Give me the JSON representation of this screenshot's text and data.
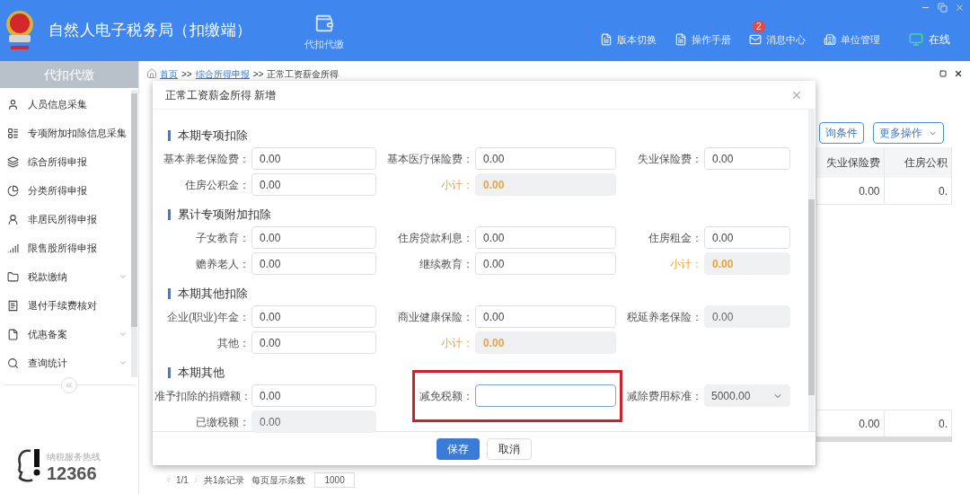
{
  "app": {
    "title": "自然人电子税务局（扣缴端）",
    "module": "代扣代缴"
  },
  "header_nav": [
    {
      "label": "版本切换",
      "kind": "link"
    },
    {
      "label": "操作手册",
      "kind": "link"
    },
    {
      "label": "消息中心",
      "kind": "link",
      "badge": "2"
    },
    {
      "label": "单位管理",
      "kind": "link"
    },
    {
      "label": "在线",
      "kind": "status"
    }
  ],
  "sidebar": {
    "title": "代扣代缴",
    "items": [
      {
        "label": "人员信息采集",
        "expandable": false
      },
      {
        "label": "专项附加扣除信息采集",
        "expandable": false
      },
      {
        "label": "综合所得申报",
        "expandable": false
      },
      {
        "label": "分类所得申报",
        "expandable": false
      },
      {
        "label": "非居民所得申报",
        "expandable": false
      },
      {
        "label": "限售股所得申报",
        "expandable": false
      },
      {
        "label": "税款缴纳",
        "expandable": true
      },
      {
        "label": "退付手续费核对",
        "expandable": false
      },
      {
        "label": "优惠备案",
        "expandable": true
      },
      {
        "label": "查询统计",
        "expandable": true
      }
    ],
    "hotline_label": "纳税服务热线",
    "hotline_number": "12366"
  },
  "breadcrumb": {
    "separator": ">>",
    "items": [
      {
        "label": "首页",
        "link": true
      },
      {
        "label": "综合所得申报",
        "link": true
      },
      {
        "label": "正常工资薪金所得",
        "link": false
      }
    ]
  },
  "background": {
    "buttons": [
      {
        "label": "询条件",
        "menu": false
      },
      {
        "label": "更多操作",
        "menu": true
      }
    ],
    "table": {
      "columns": [
        "失业保险费",
        "住房公积"
      ],
      "rows": [
        [
          "0.00",
          "0."
        ]
      ],
      "totals": [
        "0.00",
        "0."
      ]
    },
    "pagination": {
      "pages": "1/1",
      "total": "共1条记录",
      "page_size_label": "每页显示条数",
      "page_size": "1000"
    }
  },
  "dialog": {
    "title": "正常工资薪金所得 新增",
    "sections": [
      {
        "title": "本期专项扣除",
        "rows": [
          [
            {
              "label": "基本养老保险费：",
              "value": "0.00",
              "kind": "input"
            },
            {
              "label": "基本医疗保险费：",
              "value": "0.00",
              "kind": "input"
            },
            {
              "label": "失业保险费：",
              "value": "0.00",
              "kind": "input"
            }
          ],
          [
            {
              "label": "住房公积金：",
              "value": "0.00",
              "kind": "input"
            },
            {
              "label": "小计：",
              "value": "0.00",
              "kind": "subtotal"
            },
            null
          ]
        ]
      },
      {
        "title": "累计专项附加扣除",
        "rows": [
          [
            {
              "label": "子女教育：",
              "value": "0.00",
              "kind": "input"
            },
            {
              "label": "住房贷款利息：",
              "value": "0.00",
              "kind": "input"
            },
            {
              "label": "住房租金：",
              "value": "0.00",
              "kind": "input"
            }
          ],
          [
            {
              "label": "赡养老人：",
              "value": "0.00",
              "kind": "input"
            },
            {
              "label": "继续教育：",
              "value": "0.00",
              "kind": "input"
            },
            {
              "label": "小计：",
              "value": "0.00",
              "kind": "subtotal"
            }
          ]
        ]
      },
      {
        "title": "本期其他扣除",
        "rows": [
          [
            {
              "label": "企业(职业)年金：",
              "value": "0.00",
              "kind": "input"
            },
            {
              "label": "商业健康保险：",
              "value": "0.00",
              "kind": "input"
            },
            {
              "label": "税延养老保险：",
              "value": "0.00",
              "kind": "readonly"
            }
          ],
          [
            {
              "label": "其他：",
              "value": "0.00",
              "kind": "input"
            },
            {
              "label": "小计：",
              "value": "0.00",
              "kind": "subtotal"
            },
            null
          ]
        ]
      },
      {
        "title": "本期其他",
        "rows": [
          [
            {
              "label": "准予扣除的捐赠额：",
              "value": "0.00",
              "kind": "input"
            },
            {
              "label": "减免税额：",
              "kind": "highlighted"
            },
            {
              "label": "减除费用标准：",
              "value": "5000.00",
              "kind": "select"
            }
          ],
          [
            {
              "label": "已缴税额：",
              "value": "0.00",
              "kind": "readonly"
            },
            null,
            null
          ]
        ]
      }
    ],
    "buttons": [
      {
        "label": "保存",
        "primary": true
      },
      {
        "label": "取消",
        "primary": false
      }
    ]
  }
}
